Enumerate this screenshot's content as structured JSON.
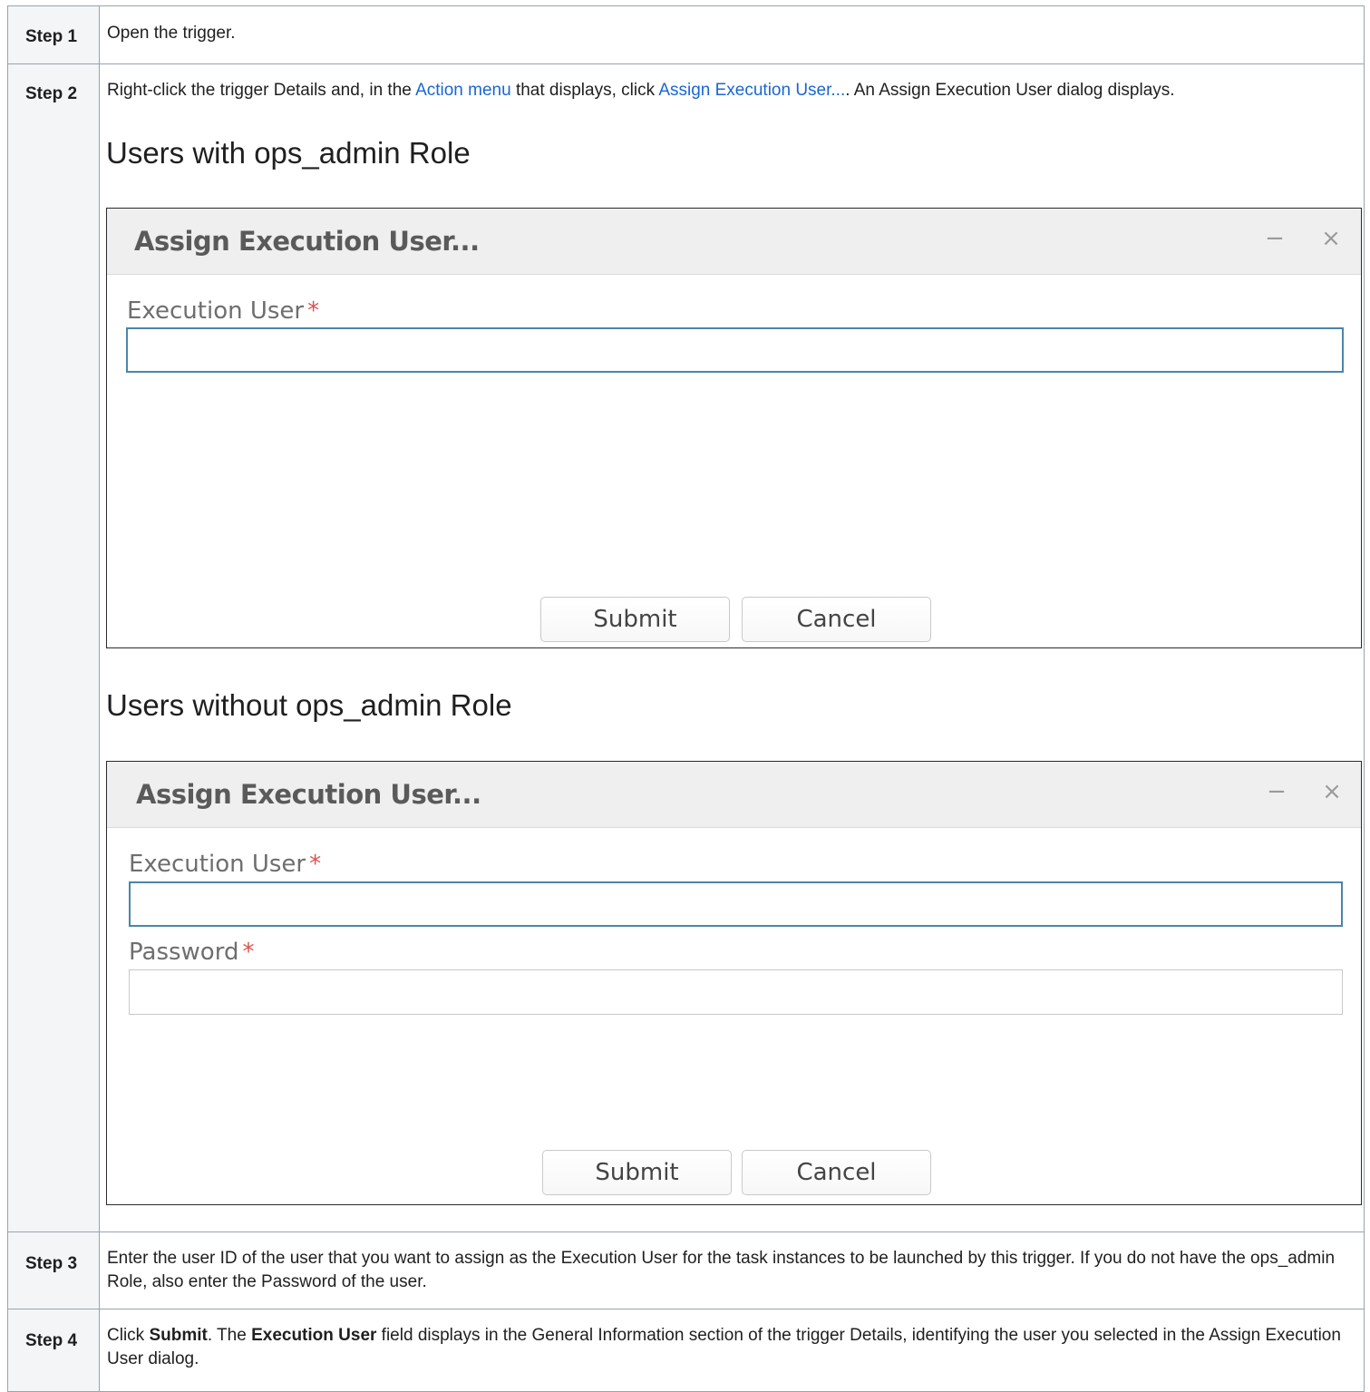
{
  "steps": [
    {
      "label": "Step 1",
      "text": "Open the trigger."
    },
    {
      "label": "Step 2",
      "text_part1": "Right-click the trigger Details and, in the ",
      "link_action_menu": "Action menu",
      "text_part2": " that displays, click ",
      "link_assign": "Assign Execution User...",
      "text_part3": ". An Assign Execution User dialog displays.",
      "section1_heading": "Users with ops_admin Role",
      "section2_heading": "Users without ops_admin Role"
    },
    {
      "label": "Step 3",
      "text": "Enter the user ID of the user that you want to assign as the Execution User for the task instances to be launched by this trigger. If you do not have the ops_admin Role, also enter the Password of the user."
    },
    {
      "label": "Step 4",
      "text_part1": "Click ",
      "bold_submit": "Submit",
      "text_part2": ". The ",
      "bold_exec_user": "Execution User",
      "text_part3": " field displays in the General Information section of the trigger Details, identifying the user you selected in the Assign Execution User dialog."
    }
  ],
  "dialog_admin": {
    "title": "Assign Execution User...",
    "minimize_glyph": "−",
    "close_glyph": "×",
    "execution_user_label": "Execution User",
    "required_mark": "*",
    "execution_user_value": "",
    "submit_label": "Submit",
    "cancel_label": "Cancel"
  },
  "dialog_non_admin": {
    "title": "Assign Execution User...",
    "minimize_glyph": "−",
    "close_glyph": "×",
    "execution_user_label": "Execution User",
    "password_label": "Password",
    "required_mark": "*",
    "execution_user_value": "",
    "password_value": "",
    "submit_label": "Submit",
    "cancel_label": "Cancel"
  }
}
